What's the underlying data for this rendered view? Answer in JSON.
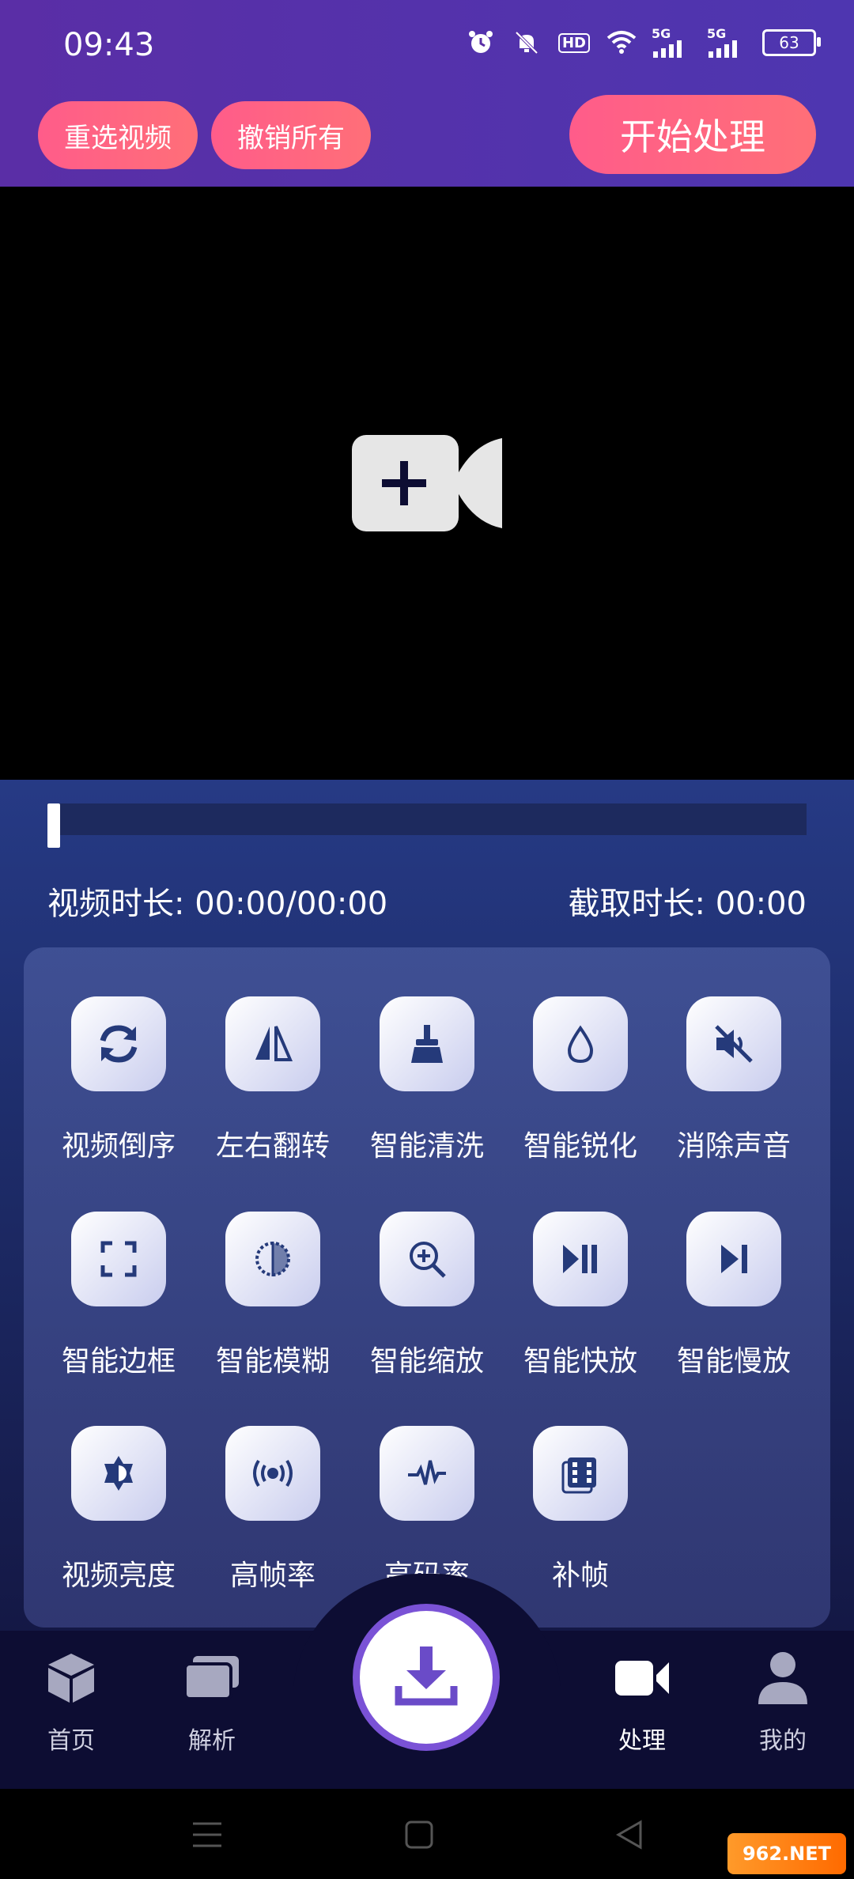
{
  "status_bar": {
    "time": "09:43",
    "icons": [
      "alarm-icon",
      "mute-icon",
      "hd-icon",
      "wifi-icon",
      "5g-signal-icon",
      "5g-signal-icon"
    ],
    "hd_label": "HD",
    "net1": "5G",
    "net2": "5G",
    "battery": "63"
  },
  "header": {
    "reselect_label": "重选视频",
    "undo_all_label": "撤销所有",
    "start_label": "开始处理"
  },
  "preview": {
    "add_icon": "video-add-icon"
  },
  "timeline": {
    "duration_label": "视频时长: 00:00/00:00",
    "clip_label": "截取时长: 00:00"
  },
  "tools": [
    {
      "label": "视频倒序",
      "icon": "refresh-icon"
    },
    {
      "label": "左右翻转",
      "icon": "flip-icon"
    },
    {
      "label": "智能清洗",
      "icon": "broom-icon"
    },
    {
      "label": "智能锐化",
      "icon": "droplet-icon"
    },
    {
      "label": "消除声音",
      "icon": "mute-speaker-icon"
    },
    {
      "label": "智能边框",
      "icon": "frame-icon"
    },
    {
      "label": "智能模糊",
      "icon": "blur-icon"
    },
    {
      "label": "智能缩放",
      "icon": "zoom-in-icon"
    },
    {
      "label": "智能快放",
      "icon": "fast-play-icon"
    },
    {
      "label": "智能慢放",
      "icon": "slow-play-icon"
    },
    {
      "label": "视频亮度",
      "icon": "brightness-icon"
    },
    {
      "label": "高帧率",
      "icon": "broadcast-icon"
    },
    {
      "label": "高码率",
      "icon": "waveform-icon"
    },
    {
      "label": "补帧",
      "icon": "film-icon"
    }
  ],
  "tabbar": {
    "home": "首页",
    "parse": "解析",
    "process": "处理",
    "mine": "我的"
  },
  "watermark": "962.NET"
}
